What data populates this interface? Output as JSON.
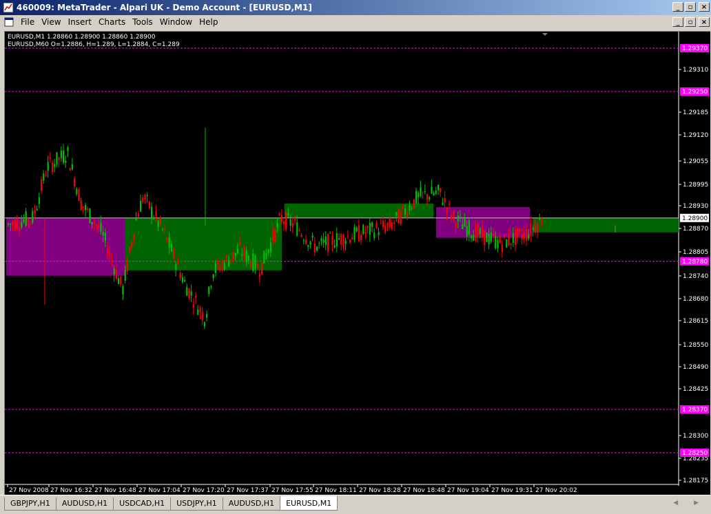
{
  "window": {
    "title": "460009: MetaTrader - Alpari UK - Demo Account - [EURUSD,M1]",
    "buttons": [
      "_",
      "6",
      "X"
    ]
  },
  "menu": {
    "items": [
      "File",
      "View",
      "Insert",
      "Charts",
      "Tools",
      "Window",
      "Help"
    ]
  },
  "chart": {
    "info_line1": "EURUSD,M1  1.28860 1.28900 1.28860 1.28900",
    "info_line2": "EURUSD,M60   O=1.2886,  H=1.289,  L=1.2884,  C=1.289",
    "price_labels": [
      "1.29310",
      "1.29185",
      "1.29120",
      "1.29055",
      "1.28995",
      "1.28930",
      "1.28870",
      "1.28805",
      "1.28740",
      "1.28680",
      "1.28615",
      "1.28550",
      "1.28490",
      "1.28425",
      "1.28300",
      "1.28235",
      "1.28175"
    ],
    "highlight_labels": [
      {
        "text": "1.29370",
        "color": "#ff00ff"
      },
      {
        "text": "1.29250",
        "color": "#ff00ff"
      },
      {
        "text": "1.28900",
        "color": "#ffffff"
      },
      {
        "text": "1.28780",
        "color": "#ff00ff"
      },
      {
        "text": "1.28370",
        "color": "#ff00ff"
      },
      {
        "text": "1.28250",
        "color": "#ff00ff"
      }
    ],
    "time_labels": [
      "27 Nov 2008",
      "27 Nov 16:32",
      "27 Nov 16:48",
      "27 Nov 17:04",
      "27 Nov 17:20",
      "27 Nov 17:37",
      "27 Nov 17:55",
      "27 Nov 18:11",
      "27 Nov 18:28",
      "27 Nov 18:48",
      "27 Nov 19:04",
      "27 Nov 19:31",
      "27 Nov 20:02"
    ],
    "colors": {
      "bull": "#00c000",
      "bear": "#ff0000",
      "box_bear": "#800080",
      "box_bull": "#006400",
      "level_line": "#ff00ff"
    }
  },
  "tabs": [
    {
      "label": "GBPJPY,H1",
      "active": false
    },
    {
      "label": "AUDUSD,H1",
      "active": false
    },
    {
      "label": "USDCAD,H1",
      "active": false
    },
    {
      "label": "USDJPY,H1",
      "active": false
    },
    {
      "label": "AUDUSD,H1",
      "active": false
    },
    {
      "label": "EURUSD,M1",
      "active": true
    }
  ]
}
